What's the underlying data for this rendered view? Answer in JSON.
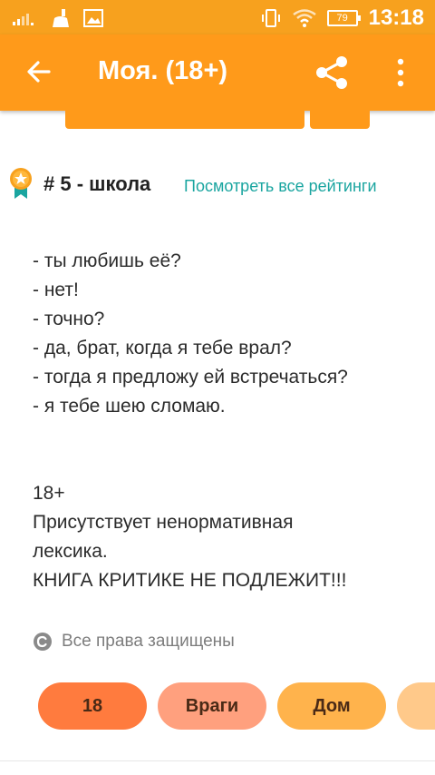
{
  "status_bar": {
    "time": "13:18",
    "battery": "79",
    "icons": [
      "signal-icon",
      "cleaner-icon",
      "image-icon",
      "vibrate-icon",
      "wifi-icon",
      "battery-icon"
    ]
  },
  "app_bar": {
    "title": "Моя. (18+)",
    "back_icon": "arrow-left-icon",
    "share_icon": "share-icon",
    "more_icon": "more-vert-icon"
  },
  "rating": {
    "rank_text": "# 5 - школа",
    "link_text": "Посмотреть все рейтинги"
  },
  "story": {
    "lines": [
      "- ты любишь её?",
      "- нет!",
      "- точно?",
      "- да, брат, когда я тебе врал?",
      "- тогда я предложу ей встречаться?",
      "- я тебе шею сломаю.",
      "",
      "",
      "18+",
      "Присутствует ненормативная",
      "лексика.",
      "КНИГА КРИТИКЕ НЕ ПОДЛЕЖИТ!!!"
    ]
  },
  "rights": {
    "text": "Все права защищены"
  },
  "tags": [
    "18",
    "Враги",
    "Дом",
    ""
  ],
  "colors": {
    "status_bar": "#f7a11e",
    "app_bar": "#ff9a1a",
    "link": "#1aa5a0",
    "tag1": "#ff7b3e",
    "tag2": "#ffa07e",
    "tag3": "#ffb34c",
    "tag4": "#ffc98a"
  }
}
